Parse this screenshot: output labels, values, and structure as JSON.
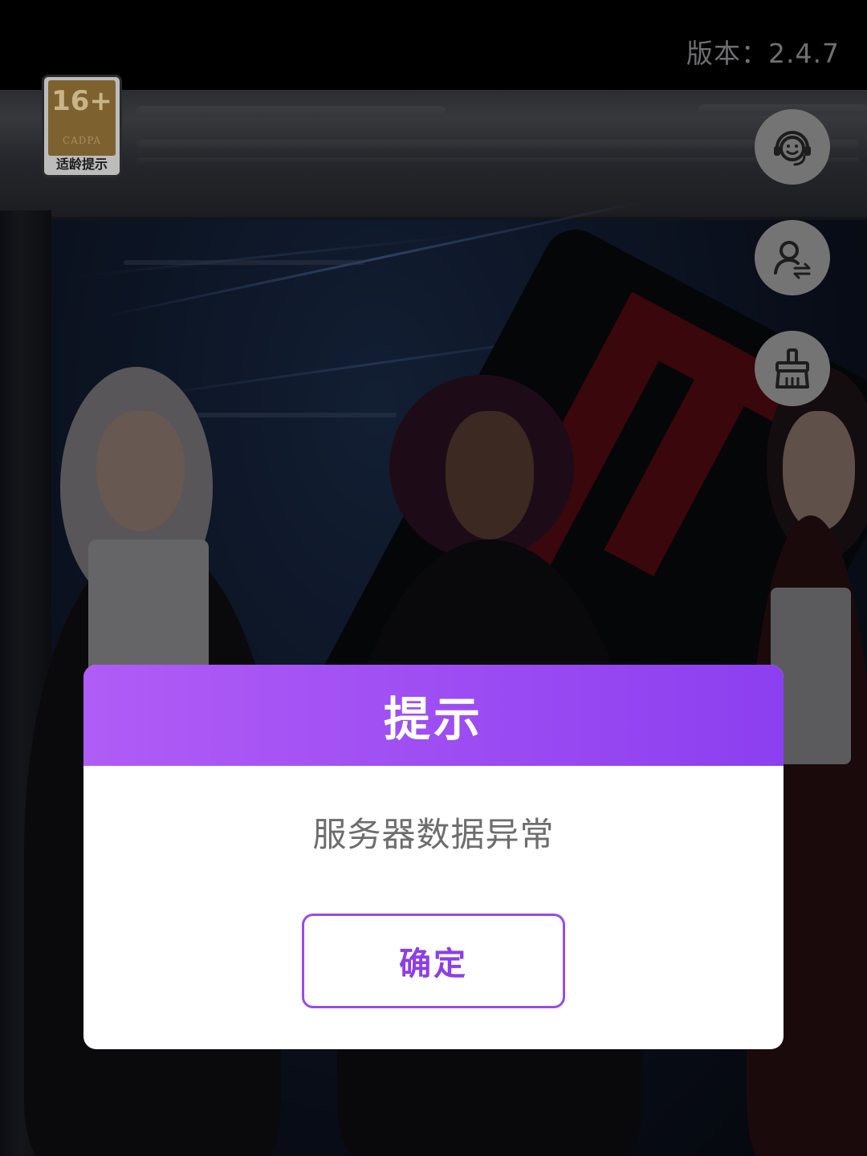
{
  "status_bar": {
    "version_text": "版本：2.4.7"
  },
  "age_rating": {
    "age": "16+",
    "org": "CADPA",
    "label": "适龄提示"
  },
  "side_buttons": [
    {
      "icon": "customer-service-icon"
    },
    {
      "icon": "switch-account-icon"
    },
    {
      "icon": "clean-cache-icon"
    }
  ],
  "dialog": {
    "title": "提示",
    "message": "服务器数据异常",
    "confirm_label": "确定"
  },
  "colors": {
    "dialog_header_gradient": [
      "#b05cf6",
      "#8c3ff0"
    ],
    "confirm_border": "#9a4be8",
    "confirm_text": "#8d3ee6",
    "message_text": "#6d6d6d",
    "side_button_bg": "#747474"
  }
}
